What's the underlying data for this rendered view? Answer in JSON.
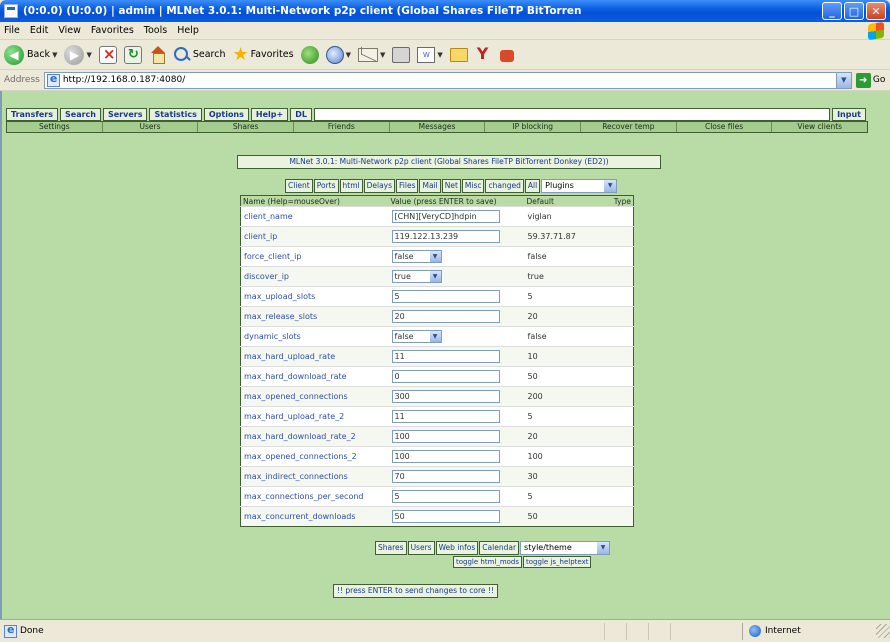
{
  "window": {
    "title": "(0:0.0) (U:0.0) | admin | MLNet 3.0.1: Multi-Network p2p client (Global Shares FileTP BitTorren"
  },
  "menu": [
    "File",
    "Edit",
    "View",
    "Favorites",
    "Tools",
    "Help"
  ],
  "toolbar": {
    "back_label": "Back",
    "search_label": "Search",
    "favorites_label": "Favorites"
  },
  "address": {
    "label": "Address",
    "url": "http://192.168.0.187:4080/",
    "go_label": "Go"
  },
  "nav_top": [
    "Transfers",
    "Search",
    "Servers",
    "Statistics",
    "Options",
    "Help+",
    "DL"
  ],
  "nav_top_right": "Input",
  "nav_sub": [
    "Settings",
    "Users",
    "Shares",
    "Friends",
    "Messages",
    "IP blocking",
    "Recover temp",
    "Close files",
    "View clients"
  ],
  "banner": "MLNet 3.0.1: Multi-Network p2p client (Global Shares FileTP BitTorrent Donkey (ED2))",
  "option_tabs": [
    "Client",
    "Ports",
    "html",
    "Delays",
    "Files",
    "Mail",
    "Net",
    "Misc",
    "changed",
    "All"
  ],
  "plugins_select": "Plugins",
  "table": {
    "headers": {
      "name": "Name (Help=mouseOver)",
      "value": "Value (press ENTER to save)",
      "default": "Default",
      "type": "Type"
    },
    "rows": [
      {
        "name": "client_name",
        "value": "[CHN][VeryCD]hdpin",
        "default": "viglan",
        "kind": "text"
      },
      {
        "name": "client_ip",
        "value": "119.122.13.239",
        "default": "59.37.71.87",
        "kind": "text"
      },
      {
        "name": "force_client_ip",
        "value": "false",
        "default": "false",
        "kind": "select"
      },
      {
        "name": "discover_ip",
        "value": "true",
        "default": "true",
        "kind": "select"
      },
      {
        "name": "max_upload_slots",
        "value": "5",
        "default": "5",
        "kind": "text"
      },
      {
        "name": "max_release_slots",
        "value": "20",
        "default": "20",
        "kind": "text"
      },
      {
        "name": "dynamic_slots",
        "value": "false",
        "default": "false",
        "kind": "select"
      },
      {
        "name": "max_hard_upload_rate",
        "value": "11",
        "default": "10",
        "kind": "text"
      },
      {
        "name": "max_hard_download_rate",
        "value": "0",
        "default": "50",
        "kind": "text"
      },
      {
        "name": "max_opened_connections",
        "value": "300",
        "default": "200",
        "kind": "text"
      },
      {
        "name": "max_hard_upload_rate_2",
        "value": "11",
        "default": "5",
        "kind": "text"
      },
      {
        "name": "max_hard_download_rate_2",
        "value": "100",
        "default": "20",
        "kind": "text"
      },
      {
        "name": "max_opened_connections_2",
        "value": "100",
        "default": "100",
        "kind": "text"
      },
      {
        "name": "max_indirect_connections",
        "value": "70",
        "default": "30",
        "kind": "text"
      },
      {
        "name": "max_connections_per_second",
        "value": "5",
        "default": "5",
        "kind": "text"
      },
      {
        "name": "max_concurrent_downloads",
        "value": "50",
        "default": "50",
        "kind": "text"
      }
    ]
  },
  "bottom_tabs": [
    "Shares",
    "Users",
    "Web infos",
    "Calendar"
  ],
  "style_select": "style/theme",
  "toggles": [
    "toggle html_mods",
    "toggle js_helptext"
  ],
  "submit_label": "!! press ENTER to send changes to core !!",
  "status": {
    "text": "Done",
    "zone": "Internet"
  },
  "colors": {
    "page_bg": "#b9dba6",
    "title_blue": "#0a5fe3",
    "link_blue": "#2f4ea8"
  }
}
